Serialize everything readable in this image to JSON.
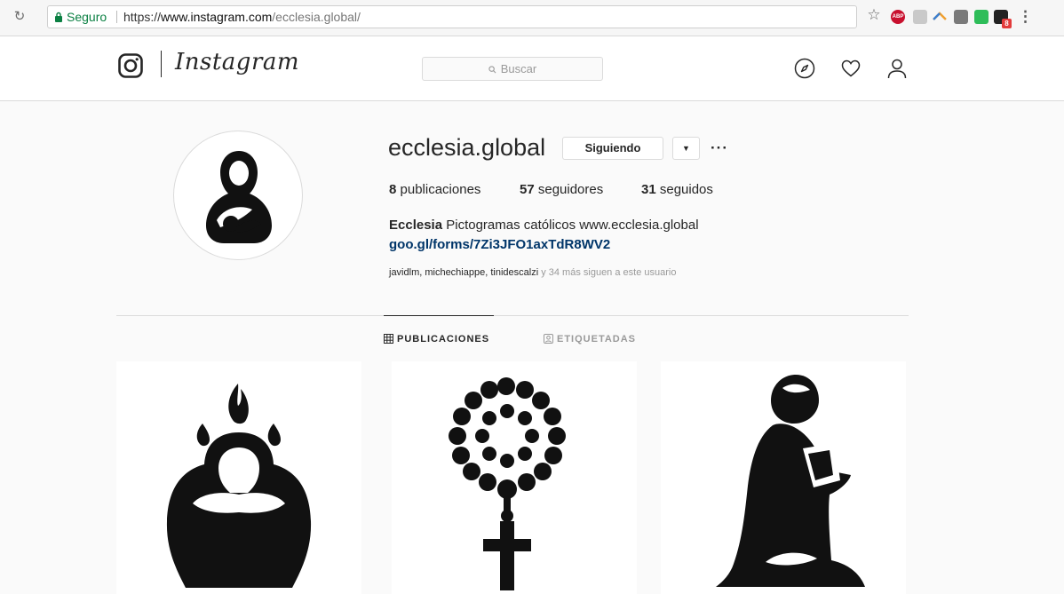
{
  "browser": {
    "secure_label": "Seguro",
    "url_scheme": "https://",
    "url_host": "www.instagram.com",
    "url_path": "/ecclesia.global/",
    "extensions": [
      "abp-icon",
      "extension-icon",
      "rainbow-icon",
      "shield-icon",
      "green-extension-icon",
      "dark-extension-icon"
    ],
    "abp_label": "ABP",
    "badge_count": "8"
  },
  "header": {
    "brand": "Instagram",
    "search_placeholder": "Buscar",
    "icons": [
      "compass-icon",
      "heart-icon",
      "user-icon"
    ]
  },
  "profile": {
    "username": "ecclesia.global",
    "follow_button": "Siguiendo",
    "stats": [
      {
        "count": "8",
        "label": "publicaciones"
      },
      {
        "count": "57",
        "label": "seguidores"
      },
      {
        "count": "31",
        "label": "seguidos"
      }
    ],
    "bio_name": "Ecclesia",
    "bio_text": "Pictogramas católicos www.ecclesia.global",
    "bio_link": "goo.gl/forms/7Zi3JFO1axTdR8WV2",
    "followed_by_names": "javidlm, michechiappe, tinidescalzi",
    "followed_by_rest": "y 34 más siguen a este usuario"
  },
  "tabs": [
    {
      "label": "PUBLICACIONES",
      "active": true
    },
    {
      "label": "ETIQUETADAS",
      "active": false
    }
  ],
  "posts": [
    {
      "icon": "pentecost-figure-icon"
    },
    {
      "icon": "rosary-icon"
    },
    {
      "icon": "praying-figure-icon"
    }
  ]
}
